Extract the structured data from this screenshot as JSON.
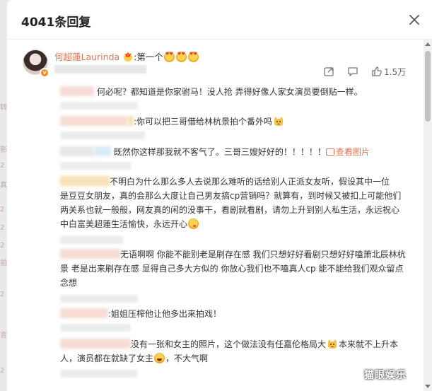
{
  "dialog": {
    "title": "4041条回复",
    "close_icon": "close-icon"
  },
  "background_letters": [
    "、",
    "转",
    "影",
    "2",
    "真",
    "2",
    "2",
    "2",
    "前",
    "2",
    "言",
    "2"
  ],
  "main_comment": {
    "username": "何超蓮Laurinda",
    "text": ":第一个",
    "avatar_badge": "v",
    "like_count": "1.5万",
    "icons": [
      "share-icon",
      "comment-icon",
      "like-icon"
    ]
  },
  "replies": [
    {
      "text": "何必呢？都知道是你家驸马！没人抢  弄得好像人家女演员要倒贴一样。"
    },
    {
      "text": ":你可以把三哥借给林杭景拍个番外吗"
    },
    {
      "text": "既然你这样那我就不客气了。三哥三嫂好好的！！！！！",
      "pic_label": "查看图片"
    },
    {
      "lines": [
        "不明白为什么那么多人去说那么难听的话给别人正派女友听，假设其中一位",
        "是豆豆女朋友，真的会那么大度让自己男友搞cp营销吗？就算有，到时候又被扣上可能他们",
        "两关系也就一般般，网友真的闲的没事干，看剧就看剧，请勿上升到别人私生活，永远祝心",
        "中白富美超蓮生活愉快，永远开心"
      ]
    },
    {
      "lines": [
        "无语啊啊 你能不能别老是刷存在感  我们只想好好看剧只想好好嗑萧北辰林杭",
        "景 老是出来刷存在感 显得自己多大方似的 你放心我们也不嗑真人cp  能不能给我们观众留点",
        "念想"
      ]
    },
    {
      "text": ":姐姐压榨他让他多出来拍戏！"
    },
    {
      "lines": [
        "没有一张和女主的照片，这个做法没有任嘉伦格局大",
        "本来就不上升本",
        "人，演员都在就缺了女主",
        "，不大气啊"
      ]
    }
  ],
  "watermark": "猫眼娱乐"
}
